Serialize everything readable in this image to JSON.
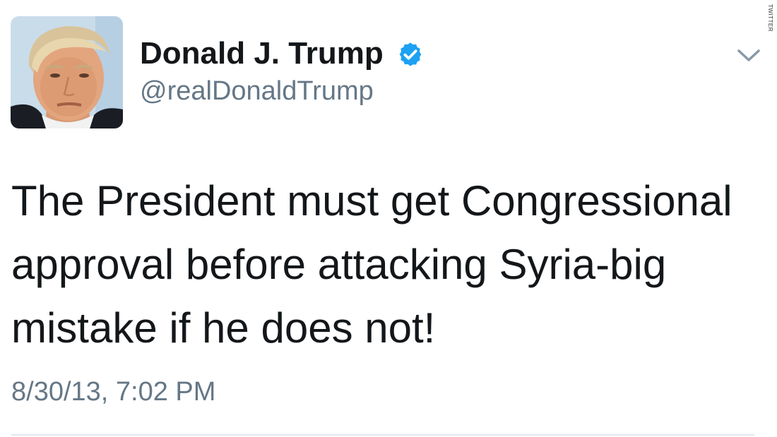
{
  "tweet": {
    "author": {
      "display_name": "Donald J. Trump",
      "handle": "@realDonaldTrump",
      "verified": true,
      "avatar_icon": "profile-photo"
    },
    "text": "The President must get Congressional approval before attacking Syria-big mistake if he does not!",
    "timestamp": "8/30/13, 7:02 PM",
    "menu_icon": "chevron-down-icon"
  },
  "watermark": "TWITTER",
  "colors": {
    "primary_text": "#14171a",
    "secondary_text": "#657786",
    "verified_blue": "#1da1f2",
    "divider": "#e1e8ed"
  }
}
